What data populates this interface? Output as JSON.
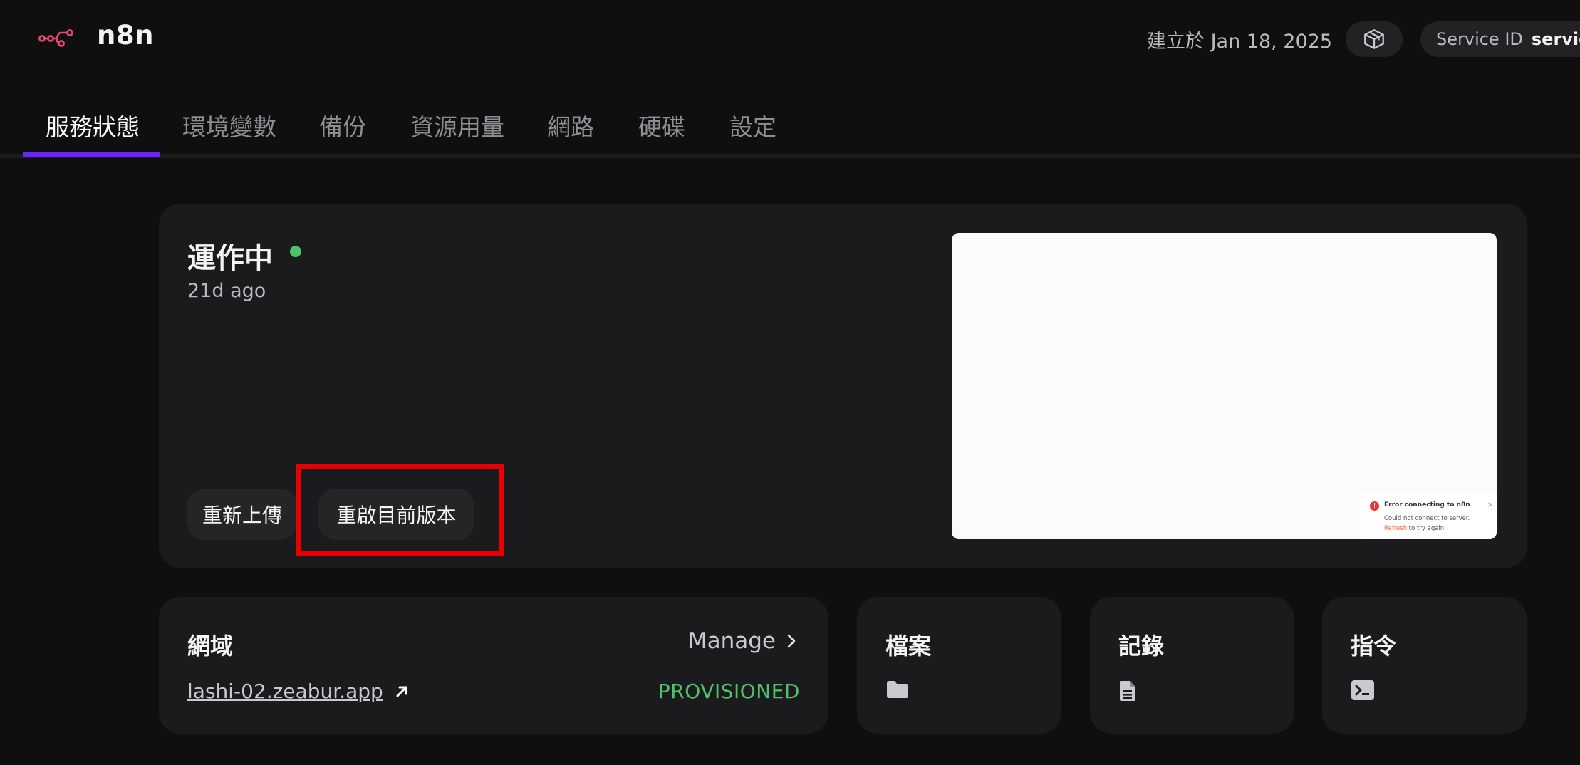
{
  "app": {
    "title": "n8n",
    "created": "建立於 Jan 18, 2025",
    "service_id_label": "Service ID",
    "service_id_value": "service",
    "accent": "#6b24ff",
    "logo_color": "#e94a6b"
  },
  "tabs": [
    {
      "label": "服務狀態",
      "active": true
    },
    {
      "label": "環境變數"
    },
    {
      "label": "備份"
    },
    {
      "label": "資源用量"
    },
    {
      "label": "網路"
    },
    {
      "label": "硬碟"
    },
    {
      "label": "設定"
    }
  ],
  "status": {
    "title": "運作中",
    "ago": "21d ago",
    "dot_color": "#4fc26c",
    "redeploy_label": "重新上傳",
    "restart_label": "重啟目前版本"
  },
  "preview": {
    "toast_title": "Error connecting to n8n",
    "toast_close": "×",
    "toast_msg": "Could not connect to server. ",
    "toast_refresh": "Refresh",
    "toast_msg2": " to try again"
  },
  "domain": {
    "title": "網域",
    "manage_label": "Manage",
    "url": "lashi-02.zeabur.app",
    "status": "PROVISIONED"
  },
  "files": {
    "title": "檔案",
    "icon": "folder-icon"
  },
  "logs": {
    "title": "記錄",
    "icon": "file-text-icon"
  },
  "commands": {
    "title": "指令",
    "icon": "terminal-icon"
  }
}
